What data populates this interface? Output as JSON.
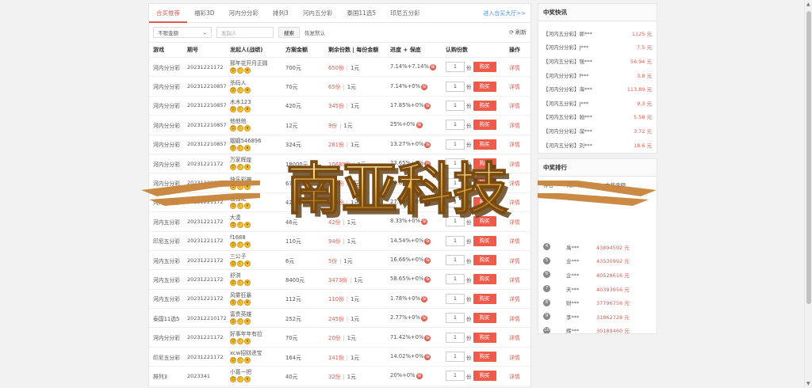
{
  "tabs": [
    "合买推荐",
    "福彩3D",
    "河内分分彩",
    "排列3",
    "河内五分彩",
    "泰国11选5",
    "印尼五分彩"
  ],
  "more_link": "进入合买大厅>>",
  "filter": {
    "select": "不限金额",
    "input_placeholder": "发起人",
    "search": "搜索",
    "reset": "恢复默认",
    "refresh": "刷新"
  },
  "table": {
    "headers": [
      "游戏",
      "期号",
      "发起人(战绩)",
      "方案金额",
      "剩余份数 | 每份金额",
      "进度 + 保底",
      "认购份数",
      "操作"
    ],
    "buy_label": "购买",
    "detail_label": "详情",
    "unit": "份",
    "rows": [
      {
        "game": "河内分分彩",
        "issue": "20231221172",
        "user": "那年花开月正圆",
        "amount": "700元",
        "remain": "650份",
        "per": "1元",
        "progress": "7.14%+7.14%",
        "qty": "1"
      },
      {
        "game": "河内分分彩",
        "issue": "202312210857",
        "user": "杀码人",
        "amount": "70元",
        "remain": "65份",
        "per": "1元",
        "progress": "7.14%+0%",
        "qty": "1"
      },
      {
        "game": "河内分分彩",
        "issue": "202312210857",
        "user": "木木123",
        "amount": "420元",
        "remain": "345份",
        "per": "1元",
        "progress": "17.85%+0%",
        "qty": "1"
      },
      {
        "game": "河内分分彩",
        "issue": "202312210857",
        "user": "他他他",
        "amount": "12元",
        "remain": "9份",
        "per": "1元",
        "progress": "25%+0%",
        "qty": "1"
      },
      {
        "game": "河内分分彩",
        "issue": "202312210857",
        "user": "姻姻546896",
        "amount": "324元",
        "remain": "281份",
        "per": "1元",
        "progress": "13.27%+0%",
        "qty": "1"
      },
      {
        "game": "河内分分彩",
        "issue": "20231221172",
        "user": "万家辉煌",
        "amount": "18000元",
        "remain": "10680份",
        "per": "1元",
        "progress": "23.65%+0%",
        "qty": "1"
      },
      {
        "game": "河内分分彩",
        "issue": "202312210857",
        "user": "快乐彩神",
        "amount": "672元",
        "remain": "505份",
        "per": "1元",
        "progress": "24.85%+0%",
        "qty": "1"
      },
      {
        "game": "河内五分彩",
        "issue": "20231221172",
        "user": "强强北",
        "amount": "420元",
        "remain": "304份",
        "per": "1元",
        "progress": "27.89%+0%",
        "qty": "1"
      },
      {
        "game": "河内五分彩",
        "issue": "20231221172",
        "user": "大漠",
        "amount": "46元",
        "remain": "42份",
        "per": "1元",
        "progress": "8.33%+0%",
        "qty": "1"
      },
      {
        "game": "印尼五分彩",
        "issue": "20231221172",
        "user": "f1688",
        "amount": "110元",
        "remain": "94份",
        "per": "1元",
        "progress": "14.54%+0%",
        "qty": "1"
      },
      {
        "game": "河内五分彩",
        "issue": "20231221172",
        "user": "三公子",
        "amount": "6元",
        "remain": "5份",
        "per": "1元",
        "progress": "16.66%+0%",
        "qty": "1"
      },
      {
        "game": "河内五分彩",
        "issue": "20231221172",
        "user": "舒淇",
        "amount": "8400元",
        "remain": "3473份",
        "per": "1元",
        "progress": "58.65%+0%",
        "qty": "1"
      },
      {
        "game": "河内五分彩",
        "issue": "20231221172",
        "user": "风雾狂暴",
        "amount": "112元",
        "remain": "110份",
        "per": "1元",
        "progress": "1.78%+0%",
        "qty": "1"
      },
      {
        "game": "泰国11选5",
        "issue": "202312210172",
        "user": "富贵英雄",
        "amount": "252元",
        "remain": "245份",
        "per": "1元",
        "progress": "2.77%+0%",
        "qty": "1"
      },
      {
        "game": "河内分分彩",
        "issue": "20231221172",
        "user": "好事年年有拉",
        "amount": "70元",
        "remain": "20份",
        "per": "1元",
        "progress": "71.42%+0%",
        "qty": "1"
      },
      {
        "game": "印尼五分彩",
        "issue": "20231221172",
        "user": "xcw招财进宝",
        "amount": "164元",
        "remain": "141份",
        "per": "1元",
        "progress": "14.02%+0%",
        "qty": "1"
      },
      {
        "game": "排列3",
        "issue": "2023341",
        "user": "小葛一把",
        "amount": "40元",
        "remain": "32份",
        "per": "1元",
        "progress": "20%+0%",
        "qty": "1"
      }
    ]
  },
  "news": {
    "title": "中奖快讯",
    "items": [
      {
        "who": "【河内五分彩】郭***",
        "amt": "1125 元"
      },
      {
        "who": "【河内分分彩】J***",
        "amt": "7.5 元"
      },
      {
        "who": "【河内五分彩】强***",
        "amt": "56.94 元"
      },
      {
        "who": "【河内分分彩】f***",
        "amt": "3.8 元"
      },
      {
        "who": "【河内分分彩】海***",
        "amt": "113.89 元"
      },
      {
        "who": "【河内五分彩】J***",
        "amt": "9.3 元"
      },
      {
        "who": "【河内五分彩】驰***",
        "amt": "5.58 元"
      },
      {
        "who": "【河内分分彩】溜***",
        "amt": "3.72 元"
      },
      {
        "who": "【河内五分彩】刘***",
        "amt": "18.6 元"
      }
    ]
  },
  "rank": {
    "title": "中奖排行",
    "head_rank": "排名",
    "head_user": "用户名",
    "head_amount": "中奖金额",
    "items": [
      {
        "no": "4",
        "name": "禹***",
        "money": "43894592 元"
      },
      {
        "no": "5",
        "name": "业***",
        "money": "43530992 元"
      },
      {
        "no": "6",
        "name": "企***",
        "money": "40528616 元"
      },
      {
        "no": "7",
        "name": "天***",
        "money": "40393956 元"
      },
      {
        "no": "8",
        "name": "财***",
        "money": "37796756 元"
      },
      {
        "no": "9",
        "name": "李***",
        "money": "31862728 元"
      },
      {
        "no": "10",
        "name": "辉***",
        "money": "30189460 元"
      }
    ]
  },
  "watermark": {
    "text": "南亚科技"
  },
  "colors": {
    "accent": "#e25a4e",
    "buy_button": "#f05a4a",
    "link": "#4a90d9"
  }
}
